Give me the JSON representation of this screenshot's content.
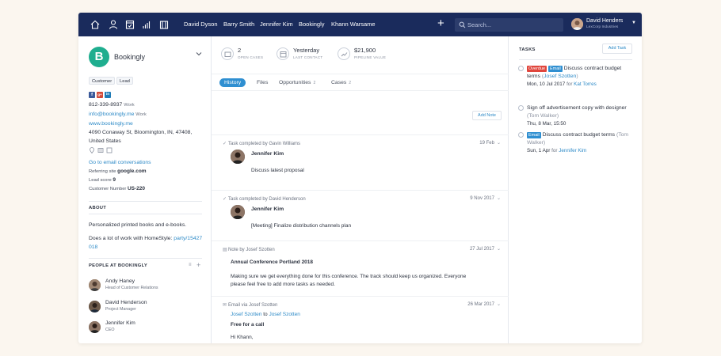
{
  "nav": {
    "icons": [
      "home-icon",
      "person-icon",
      "calendar-check-icon",
      "bar-chart-icon",
      "briefcase-icon"
    ],
    "links": [
      "David Dyson",
      "Barry Smith",
      "Jennifer Kim",
      "Bookingly",
      "Khann Warsame"
    ],
    "add_label": "+",
    "search_placeholder": "Search...",
    "user_name": "David Henders",
    "user_company": "LexCorp Industries"
  },
  "company": {
    "logo_letter": "B",
    "name": "Bookingly",
    "tags": [
      "Customer",
      "Lead"
    ],
    "social": [
      "f",
      "g+",
      "in"
    ],
    "phone": "812-339-8937",
    "phone_type": "Work",
    "email": "info@bookingly.me",
    "email_type": "Work",
    "website": "www.bookingly.me",
    "address_line1": "4090 Conaway St, Bloomington, IN, 47408,",
    "address_line2": "United States",
    "email_conversations": "Go to email conversations",
    "referring_site_label": "Referring site",
    "referring_site": "google.com",
    "lead_score_label": "Lead score",
    "lead_score": "9",
    "customer_number_label": "Customer Number",
    "customer_number": "US-220"
  },
  "about": {
    "title": "ABOUT",
    "line1": "Personalized printed books and e-books.",
    "line2_prefix": "Does a lot of work with HomeStyle:",
    "line2_link_a": "party/15427",
    "line2_link_b": "018"
  },
  "people": {
    "title": "PEOPLE AT BOOKINGLY",
    "list": [
      {
        "name": "Andy Haney",
        "role": "Head of Customer Relations"
      },
      {
        "name": "David Henderson",
        "role": "Project Manager"
      },
      {
        "name": "Jennifer Kim",
        "role": "CEO"
      }
    ]
  },
  "stats": [
    {
      "value": "2",
      "label": "OPEN CASES"
    },
    {
      "value": "Yesterday",
      "label": "LAST CONTACT"
    },
    {
      "value": "$21,900",
      "label": "PIPELINE VALUE"
    }
  ],
  "tabs": [
    {
      "label": "History",
      "count": ""
    },
    {
      "label": "Files",
      "count": ""
    },
    {
      "label": "Opportunities",
      "count": "2"
    },
    {
      "label": "Cases",
      "count": "2"
    }
  ],
  "add_note": "Add Note",
  "feed": [
    {
      "head": "Task completed by Gavin Williams",
      "date": "19 Feb",
      "person": "Jennifer Kim",
      "body": "Discuss latest proposal"
    },
    {
      "head": "Task completed by David Henderson",
      "date": "9 Nov 2017",
      "person": "Jennifer Kim",
      "body": "[Meeting] Finalize distribution channels plan"
    },
    {
      "head": "Note by Josef Szotten",
      "date": "27 Jul 2017",
      "title": "Annual Conference Portland 2018",
      "body_line1": "Making sure we get everything done for this conference. The track should keep us organized. Everyone",
      "body_line2": "please feel free to add more tasks as needed."
    },
    {
      "head": "Email via Josef Szotten",
      "date": "26 Mar 2017",
      "from": "Josef Szotten",
      "to_word": "to",
      "to": "Josef Szotten",
      "subject": "Free for a call",
      "greeting": "Hi Khann,"
    }
  ],
  "tasks": {
    "title": "TASKS",
    "add_label": "Add Task",
    "items": [
      {
        "badges": [
          "Overdue",
          "Email"
        ],
        "title": "Discuss contract budget terms",
        "who": "Josef Szotten",
        "date": "Mon, 10 Jul 2017",
        "for_word": "for",
        "for": "Kat Torres"
      },
      {
        "badges": [],
        "title": "Sign off advertisement copy with designer",
        "who": "Tom Walker",
        "date": "Thu, 8 Mar, 15:50"
      },
      {
        "badges": [
          "Email"
        ],
        "title": "Discuss contract budget terms",
        "who": "Tom Walker",
        "date": "Sun, 1 Apr",
        "for_word": "for",
        "for": "Jennifer Kim"
      }
    ]
  },
  "colors": {
    "nav_bg": "#1a2b5c",
    "brand_logo": "#1fae8f",
    "link": "#2d8ac7",
    "tab_active": "#2f8fd1",
    "overdue": "#e0463d",
    "email_badge": "#2f8fd1"
  }
}
